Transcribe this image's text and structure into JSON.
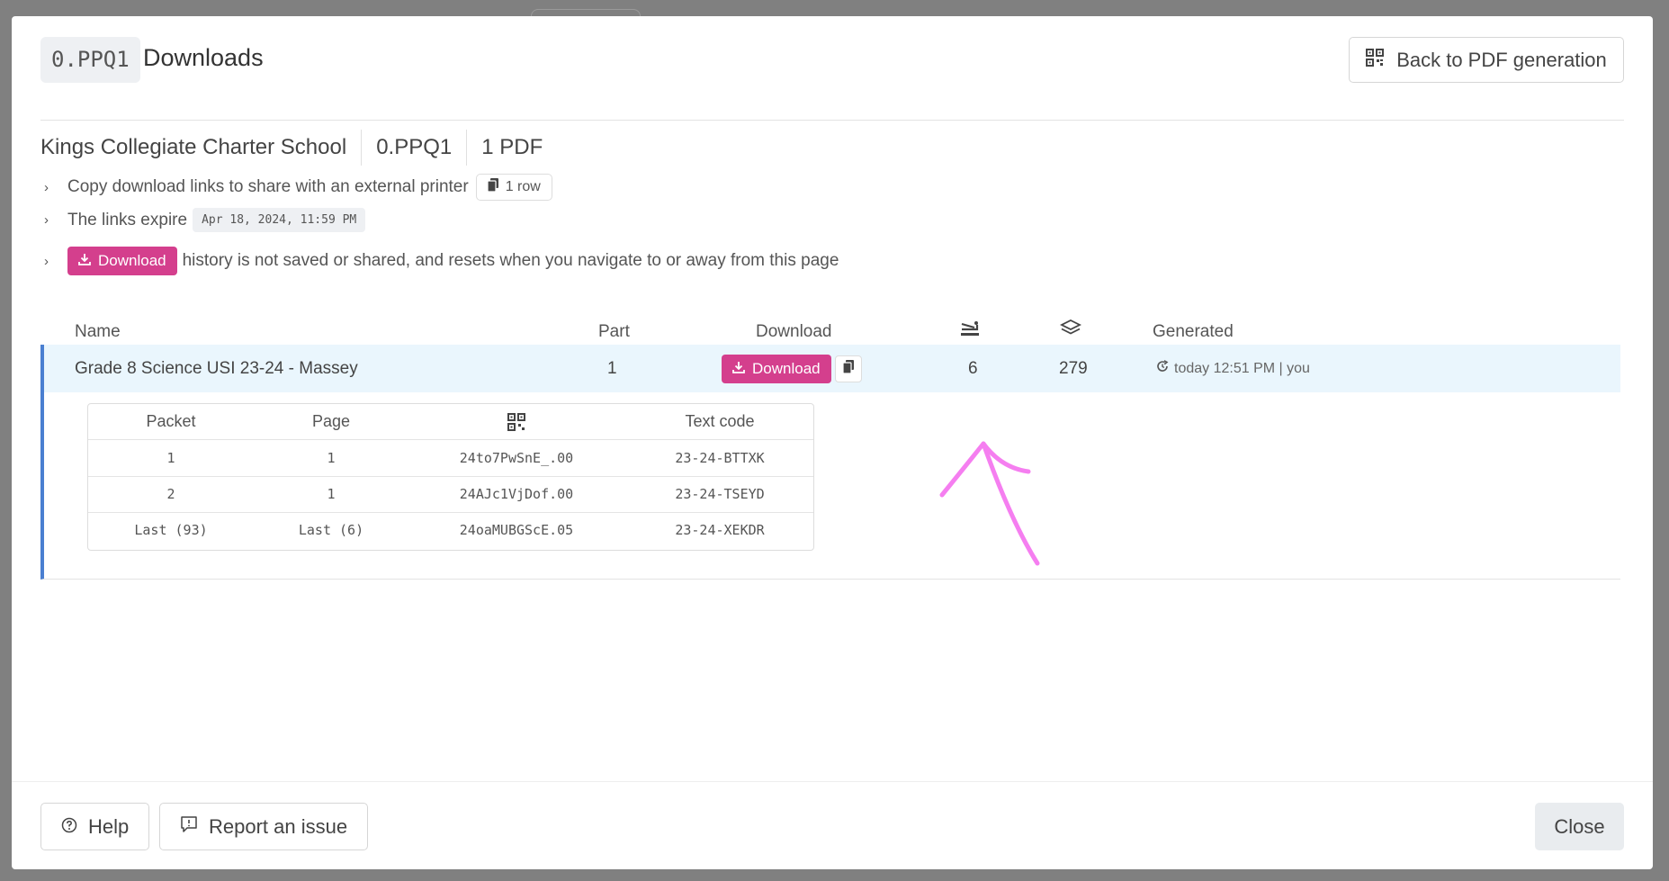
{
  "header": {
    "code": "0.PPQ1",
    "title": "Downloads",
    "back_button": "Back to PDF generation"
  },
  "info": {
    "school": "Kings Collegiate Charter School",
    "code": "0.PPQ1",
    "count": "1 PDF"
  },
  "notes": {
    "copy_text": "Copy download links to share with an external printer",
    "copy_pill": "1 row",
    "expire_text": "The links expire",
    "expire_date": "Apr 18, 2024, 11:59 PM",
    "download_label": "Download",
    "history_text": "history is not saved or shared, and resets when you navigate to or away from this page"
  },
  "table": {
    "headers": {
      "name": "Name",
      "part": "Part",
      "download": "Download",
      "generated": "Generated"
    },
    "header_icons": {
      "staple": "stapler-icon",
      "layers": "layers-icon"
    },
    "row": {
      "name": "Grade 8 Science USI 23-24 - Massey",
      "part": "1",
      "download_label": "Download",
      "staples": "6",
      "pages": "279",
      "generated": "today 12:51 PM | you"
    }
  },
  "inner_table": {
    "headers": {
      "packet": "Packet",
      "page": "Page",
      "qr": "qr-code-icon",
      "text_code": "Text code"
    },
    "rows": [
      {
        "packet": "1",
        "page": "1",
        "qr": "24to7PwSnE_.00",
        "text_code": "23-24-BTTXK"
      },
      {
        "packet": "2",
        "page": "1",
        "qr": "24AJc1VjDof.00",
        "text_code": "23-24-TSEYD"
      },
      {
        "packet": "Last (93)",
        "page": "Last (6)",
        "qr": "24oaMUBGScE.05",
        "text_code": "23-24-XEKDR"
      }
    ]
  },
  "footer": {
    "help": "Help",
    "report": "Report an issue",
    "close": "Close"
  },
  "colors": {
    "accent_pink": "#d43f8d",
    "row_highlight": "#eaf6fd",
    "row_border": "#4a7fd1",
    "annotation": "#f57ef0"
  }
}
